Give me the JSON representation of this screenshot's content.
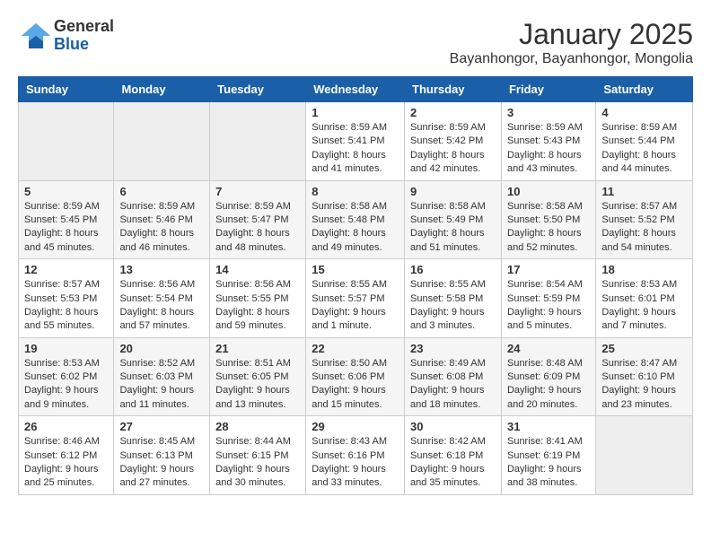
{
  "logo": {
    "general": "General",
    "blue": "Blue"
  },
  "header": {
    "month": "January 2025",
    "location": "Bayanhongor, Bayanhongor, Mongolia"
  },
  "weekdays": [
    "Sunday",
    "Monday",
    "Tuesday",
    "Wednesday",
    "Thursday",
    "Friday",
    "Saturday"
  ],
  "weeks": [
    [
      {
        "day": "",
        "info": ""
      },
      {
        "day": "",
        "info": ""
      },
      {
        "day": "",
        "info": ""
      },
      {
        "day": "1",
        "info": "Sunrise: 8:59 AM\nSunset: 5:41 PM\nDaylight: 8 hours\nand 41 minutes."
      },
      {
        "day": "2",
        "info": "Sunrise: 8:59 AM\nSunset: 5:42 PM\nDaylight: 8 hours\nand 42 minutes."
      },
      {
        "day": "3",
        "info": "Sunrise: 8:59 AM\nSunset: 5:43 PM\nDaylight: 8 hours\nand 43 minutes."
      },
      {
        "day": "4",
        "info": "Sunrise: 8:59 AM\nSunset: 5:44 PM\nDaylight: 8 hours\nand 44 minutes."
      }
    ],
    [
      {
        "day": "5",
        "info": "Sunrise: 8:59 AM\nSunset: 5:45 PM\nDaylight: 8 hours\nand 45 minutes."
      },
      {
        "day": "6",
        "info": "Sunrise: 8:59 AM\nSunset: 5:46 PM\nDaylight: 8 hours\nand 46 minutes."
      },
      {
        "day": "7",
        "info": "Sunrise: 8:59 AM\nSunset: 5:47 PM\nDaylight: 8 hours\nand 48 minutes."
      },
      {
        "day": "8",
        "info": "Sunrise: 8:58 AM\nSunset: 5:48 PM\nDaylight: 8 hours\nand 49 minutes."
      },
      {
        "day": "9",
        "info": "Sunrise: 8:58 AM\nSunset: 5:49 PM\nDaylight: 8 hours\nand 51 minutes."
      },
      {
        "day": "10",
        "info": "Sunrise: 8:58 AM\nSunset: 5:50 PM\nDaylight: 8 hours\nand 52 minutes."
      },
      {
        "day": "11",
        "info": "Sunrise: 8:57 AM\nSunset: 5:52 PM\nDaylight: 8 hours\nand 54 minutes."
      }
    ],
    [
      {
        "day": "12",
        "info": "Sunrise: 8:57 AM\nSunset: 5:53 PM\nDaylight: 8 hours\nand 55 minutes."
      },
      {
        "day": "13",
        "info": "Sunrise: 8:56 AM\nSunset: 5:54 PM\nDaylight: 8 hours\nand 57 minutes."
      },
      {
        "day": "14",
        "info": "Sunrise: 8:56 AM\nSunset: 5:55 PM\nDaylight: 8 hours\nand 59 minutes."
      },
      {
        "day": "15",
        "info": "Sunrise: 8:55 AM\nSunset: 5:57 PM\nDaylight: 9 hours\nand 1 minute."
      },
      {
        "day": "16",
        "info": "Sunrise: 8:55 AM\nSunset: 5:58 PM\nDaylight: 9 hours\nand 3 minutes."
      },
      {
        "day": "17",
        "info": "Sunrise: 8:54 AM\nSunset: 5:59 PM\nDaylight: 9 hours\nand 5 minutes."
      },
      {
        "day": "18",
        "info": "Sunrise: 8:53 AM\nSunset: 6:01 PM\nDaylight: 9 hours\nand 7 minutes."
      }
    ],
    [
      {
        "day": "19",
        "info": "Sunrise: 8:53 AM\nSunset: 6:02 PM\nDaylight: 9 hours\nand 9 minutes."
      },
      {
        "day": "20",
        "info": "Sunrise: 8:52 AM\nSunset: 6:03 PM\nDaylight: 9 hours\nand 11 minutes."
      },
      {
        "day": "21",
        "info": "Sunrise: 8:51 AM\nSunset: 6:05 PM\nDaylight: 9 hours\nand 13 minutes."
      },
      {
        "day": "22",
        "info": "Sunrise: 8:50 AM\nSunset: 6:06 PM\nDaylight: 9 hours\nand 15 minutes."
      },
      {
        "day": "23",
        "info": "Sunrise: 8:49 AM\nSunset: 6:08 PM\nDaylight: 9 hours\nand 18 minutes."
      },
      {
        "day": "24",
        "info": "Sunrise: 8:48 AM\nSunset: 6:09 PM\nDaylight: 9 hours\nand 20 minutes."
      },
      {
        "day": "25",
        "info": "Sunrise: 8:47 AM\nSunset: 6:10 PM\nDaylight: 9 hours\nand 23 minutes."
      }
    ],
    [
      {
        "day": "26",
        "info": "Sunrise: 8:46 AM\nSunset: 6:12 PM\nDaylight: 9 hours\nand 25 minutes."
      },
      {
        "day": "27",
        "info": "Sunrise: 8:45 AM\nSunset: 6:13 PM\nDaylight: 9 hours\nand 27 minutes."
      },
      {
        "day": "28",
        "info": "Sunrise: 8:44 AM\nSunset: 6:15 PM\nDaylight: 9 hours\nand 30 minutes."
      },
      {
        "day": "29",
        "info": "Sunrise: 8:43 AM\nSunset: 6:16 PM\nDaylight: 9 hours\nand 33 minutes."
      },
      {
        "day": "30",
        "info": "Sunrise: 8:42 AM\nSunset: 6:18 PM\nDaylight: 9 hours\nand 35 minutes."
      },
      {
        "day": "31",
        "info": "Sunrise: 8:41 AM\nSunset: 6:19 PM\nDaylight: 9 hours\nand 38 minutes."
      },
      {
        "day": "",
        "info": ""
      }
    ]
  ]
}
